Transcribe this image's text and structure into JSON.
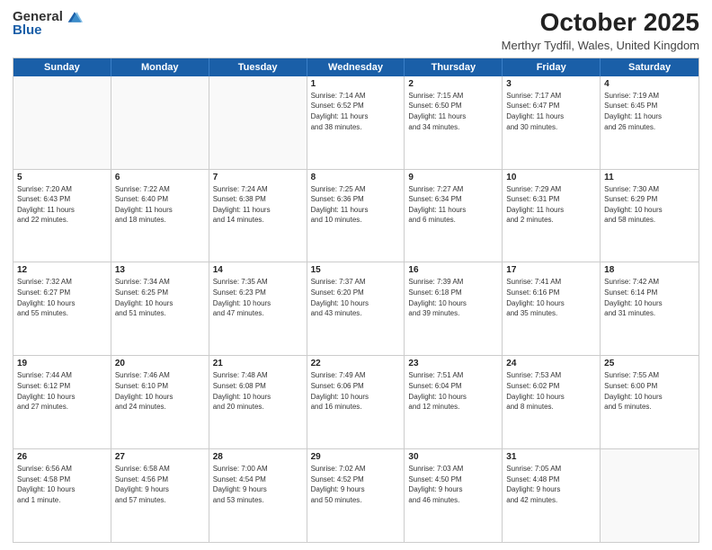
{
  "header": {
    "logo_general": "General",
    "logo_blue": "Blue",
    "month": "October 2025",
    "location": "Merthyr Tydfil, Wales, United Kingdom"
  },
  "days_of_week": [
    "Sunday",
    "Monday",
    "Tuesday",
    "Wednesday",
    "Thursday",
    "Friday",
    "Saturday"
  ],
  "weeks": [
    [
      {
        "day": "",
        "lines": []
      },
      {
        "day": "",
        "lines": []
      },
      {
        "day": "",
        "lines": []
      },
      {
        "day": "1",
        "lines": [
          "Sunrise: 7:14 AM",
          "Sunset: 6:52 PM",
          "Daylight: 11 hours",
          "and 38 minutes."
        ]
      },
      {
        "day": "2",
        "lines": [
          "Sunrise: 7:15 AM",
          "Sunset: 6:50 PM",
          "Daylight: 11 hours",
          "and 34 minutes."
        ]
      },
      {
        "day": "3",
        "lines": [
          "Sunrise: 7:17 AM",
          "Sunset: 6:47 PM",
          "Daylight: 11 hours",
          "and 30 minutes."
        ]
      },
      {
        "day": "4",
        "lines": [
          "Sunrise: 7:19 AM",
          "Sunset: 6:45 PM",
          "Daylight: 11 hours",
          "and 26 minutes."
        ]
      }
    ],
    [
      {
        "day": "5",
        "lines": [
          "Sunrise: 7:20 AM",
          "Sunset: 6:43 PM",
          "Daylight: 11 hours",
          "and 22 minutes."
        ]
      },
      {
        "day": "6",
        "lines": [
          "Sunrise: 7:22 AM",
          "Sunset: 6:40 PM",
          "Daylight: 11 hours",
          "and 18 minutes."
        ]
      },
      {
        "day": "7",
        "lines": [
          "Sunrise: 7:24 AM",
          "Sunset: 6:38 PM",
          "Daylight: 11 hours",
          "and 14 minutes."
        ]
      },
      {
        "day": "8",
        "lines": [
          "Sunrise: 7:25 AM",
          "Sunset: 6:36 PM",
          "Daylight: 11 hours",
          "and 10 minutes."
        ]
      },
      {
        "day": "9",
        "lines": [
          "Sunrise: 7:27 AM",
          "Sunset: 6:34 PM",
          "Daylight: 11 hours",
          "and 6 minutes."
        ]
      },
      {
        "day": "10",
        "lines": [
          "Sunrise: 7:29 AM",
          "Sunset: 6:31 PM",
          "Daylight: 11 hours",
          "and 2 minutes."
        ]
      },
      {
        "day": "11",
        "lines": [
          "Sunrise: 7:30 AM",
          "Sunset: 6:29 PM",
          "Daylight: 10 hours",
          "and 58 minutes."
        ]
      }
    ],
    [
      {
        "day": "12",
        "lines": [
          "Sunrise: 7:32 AM",
          "Sunset: 6:27 PM",
          "Daylight: 10 hours",
          "and 55 minutes."
        ]
      },
      {
        "day": "13",
        "lines": [
          "Sunrise: 7:34 AM",
          "Sunset: 6:25 PM",
          "Daylight: 10 hours",
          "and 51 minutes."
        ]
      },
      {
        "day": "14",
        "lines": [
          "Sunrise: 7:35 AM",
          "Sunset: 6:23 PM",
          "Daylight: 10 hours",
          "and 47 minutes."
        ]
      },
      {
        "day": "15",
        "lines": [
          "Sunrise: 7:37 AM",
          "Sunset: 6:20 PM",
          "Daylight: 10 hours",
          "and 43 minutes."
        ]
      },
      {
        "day": "16",
        "lines": [
          "Sunrise: 7:39 AM",
          "Sunset: 6:18 PM",
          "Daylight: 10 hours",
          "and 39 minutes."
        ]
      },
      {
        "day": "17",
        "lines": [
          "Sunrise: 7:41 AM",
          "Sunset: 6:16 PM",
          "Daylight: 10 hours",
          "and 35 minutes."
        ]
      },
      {
        "day": "18",
        "lines": [
          "Sunrise: 7:42 AM",
          "Sunset: 6:14 PM",
          "Daylight: 10 hours",
          "and 31 minutes."
        ]
      }
    ],
    [
      {
        "day": "19",
        "lines": [
          "Sunrise: 7:44 AM",
          "Sunset: 6:12 PM",
          "Daylight: 10 hours",
          "and 27 minutes."
        ]
      },
      {
        "day": "20",
        "lines": [
          "Sunrise: 7:46 AM",
          "Sunset: 6:10 PM",
          "Daylight: 10 hours",
          "and 24 minutes."
        ]
      },
      {
        "day": "21",
        "lines": [
          "Sunrise: 7:48 AM",
          "Sunset: 6:08 PM",
          "Daylight: 10 hours",
          "and 20 minutes."
        ]
      },
      {
        "day": "22",
        "lines": [
          "Sunrise: 7:49 AM",
          "Sunset: 6:06 PM",
          "Daylight: 10 hours",
          "and 16 minutes."
        ]
      },
      {
        "day": "23",
        "lines": [
          "Sunrise: 7:51 AM",
          "Sunset: 6:04 PM",
          "Daylight: 10 hours",
          "and 12 minutes."
        ]
      },
      {
        "day": "24",
        "lines": [
          "Sunrise: 7:53 AM",
          "Sunset: 6:02 PM",
          "Daylight: 10 hours",
          "and 8 minutes."
        ]
      },
      {
        "day": "25",
        "lines": [
          "Sunrise: 7:55 AM",
          "Sunset: 6:00 PM",
          "Daylight: 10 hours",
          "and 5 minutes."
        ]
      }
    ],
    [
      {
        "day": "26",
        "lines": [
          "Sunrise: 6:56 AM",
          "Sunset: 4:58 PM",
          "Daylight: 10 hours",
          "and 1 minute."
        ]
      },
      {
        "day": "27",
        "lines": [
          "Sunrise: 6:58 AM",
          "Sunset: 4:56 PM",
          "Daylight: 9 hours",
          "and 57 minutes."
        ]
      },
      {
        "day": "28",
        "lines": [
          "Sunrise: 7:00 AM",
          "Sunset: 4:54 PM",
          "Daylight: 9 hours",
          "and 53 minutes."
        ]
      },
      {
        "day": "29",
        "lines": [
          "Sunrise: 7:02 AM",
          "Sunset: 4:52 PM",
          "Daylight: 9 hours",
          "and 50 minutes."
        ]
      },
      {
        "day": "30",
        "lines": [
          "Sunrise: 7:03 AM",
          "Sunset: 4:50 PM",
          "Daylight: 9 hours",
          "and 46 minutes."
        ]
      },
      {
        "day": "31",
        "lines": [
          "Sunrise: 7:05 AM",
          "Sunset: 4:48 PM",
          "Daylight: 9 hours",
          "and 42 minutes."
        ]
      },
      {
        "day": "",
        "lines": []
      }
    ]
  ]
}
